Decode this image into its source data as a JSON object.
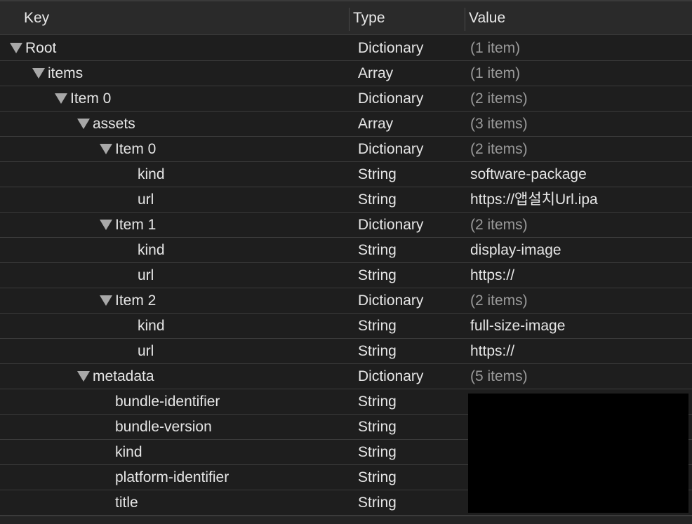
{
  "header": {
    "key": "Key",
    "type": "Type",
    "value": "Value"
  },
  "rows": [
    {
      "key": "Root",
      "type": "Dictionary",
      "value": "(1 item)",
      "depth": 0,
      "expandable": true,
      "dim": true
    },
    {
      "key": "items",
      "type": "Array",
      "value": "(1 item)",
      "depth": 1,
      "expandable": true,
      "dim": true
    },
    {
      "key": "Item 0",
      "type": "Dictionary",
      "value": "(2 items)",
      "depth": 2,
      "expandable": true,
      "dim": true
    },
    {
      "key": "assets",
      "type": "Array",
      "value": "(3 items)",
      "depth": 3,
      "expandable": true,
      "dim": true
    },
    {
      "key": "Item 0",
      "type": "Dictionary",
      "value": "(2 items)",
      "depth": 4,
      "expandable": true,
      "dim": true
    },
    {
      "key": "kind",
      "type": "String",
      "value": "software-package",
      "depth": 5,
      "expandable": false,
      "dim": false
    },
    {
      "key": "url",
      "type": "String",
      "value": "https://앱설치Url.ipa",
      "depth": 5,
      "expandable": false,
      "dim": false
    },
    {
      "key": "Item 1",
      "type": "Dictionary",
      "value": "(2 items)",
      "depth": 4,
      "expandable": true,
      "dim": true
    },
    {
      "key": "kind",
      "type": "String",
      "value": "display-image",
      "depth": 5,
      "expandable": false,
      "dim": false
    },
    {
      "key": "url",
      "type": "String",
      "value": "https://",
      "depth": 5,
      "expandable": false,
      "dim": false
    },
    {
      "key": "Item 2",
      "type": "Dictionary",
      "value": "(2 items)",
      "depth": 4,
      "expandable": true,
      "dim": true
    },
    {
      "key": "kind",
      "type": "String",
      "value": "full-size-image",
      "depth": 5,
      "expandable": false,
      "dim": false
    },
    {
      "key": "url",
      "type": "String",
      "value": "https://",
      "depth": 5,
      "expandable": false,
      "dim": false
    },
    {
      "key": "metadata",
      "type": "Dictionary",
      "value": "(5 items)",
      "depth": 3,
      "expandable": true,
      "dim": true
    },
    {
      "key": "bundle-identifier",
      "type": "String",
      "value": "",
      "depth": 4,
      "expandable": false,
      "dim": false
    },
    {
      "key": "bundle-version",
      "type": "String",
      "value": "",
      "depth": 4,
      "expandable": false,
      "dim": false
    },
    {
      "key": "kind",
      "type": "String",
      "value": "",
      "depth": 4,
      "expandable": false,
      "dim": false
    },
    {
      "key": "platform-identifier",
      "type": "String",
      "value": "",
      "depth": 4,
      "expandable": false,
      "dim": false
    },
    {
      "key": "title",
      "type": "String",
      "value": "",
      "depth": 4,
      "expandable": false,
      "dim": false
    }
  ]
}
